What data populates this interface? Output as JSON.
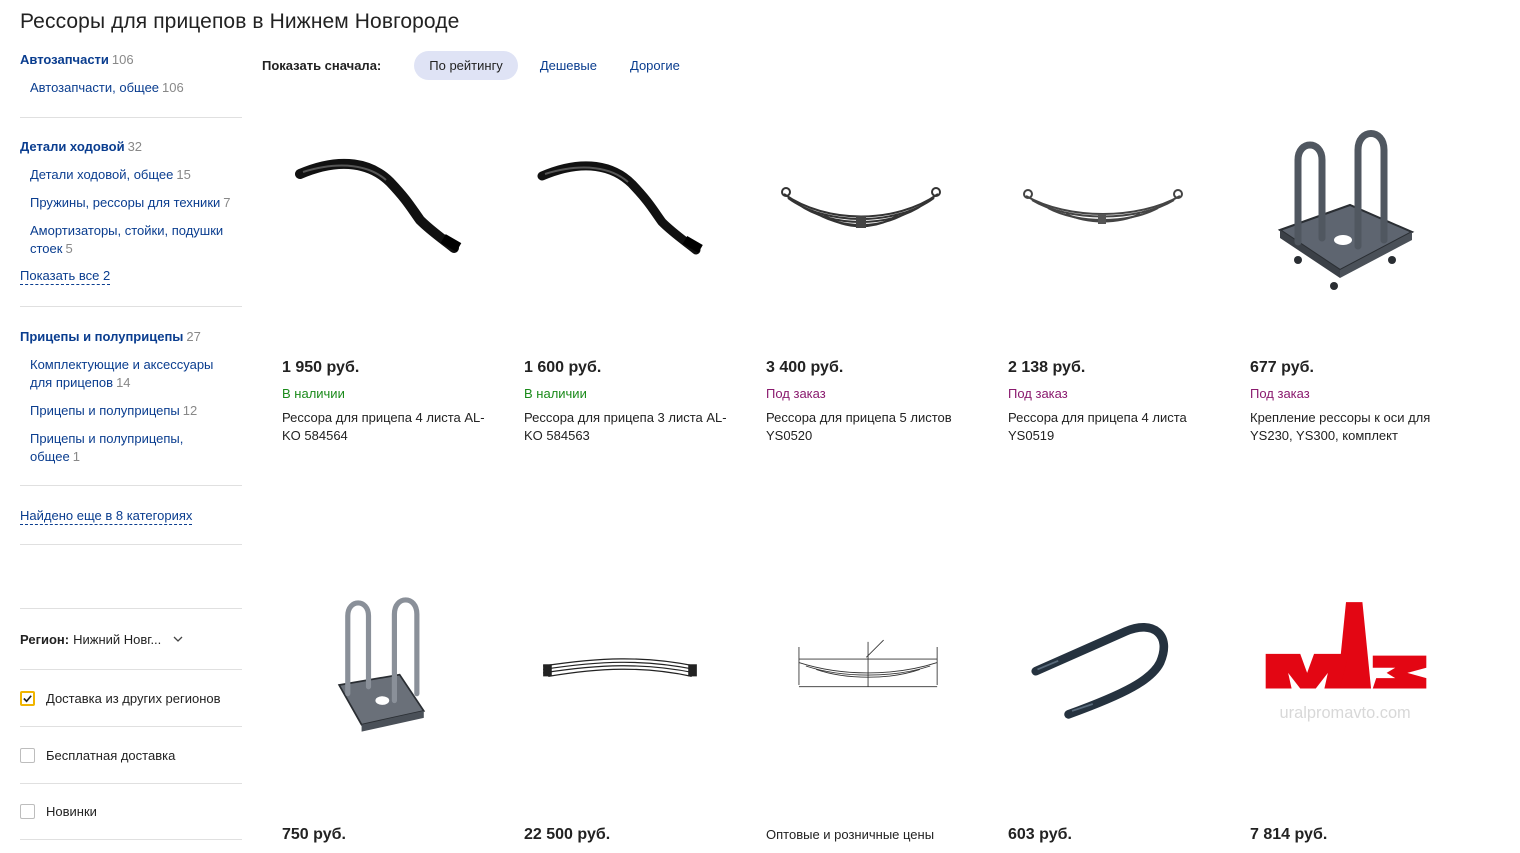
{
  "page": {
    "title": "Рессоры для прицепов в Нижнем Новгороде"
  },
  "sidebar": {
    "categories": [
      {
        "title": "Автозапчасти",
        "count": "106",
        "items": [
          {
            "label": "Автозапчасти, общее",
            "count": "106"
          }
        ]
      },
      {
        "title": "Детали ходовой",
        "count": "32",
        "items": [
          {
            "label": "Детали ходовой, общее",
            "count": "15"
          },
          {
            "label": "Пружины, рессоры для техники",
            "count": "7"
          },
          {
            "label": "Амортизаторы, стойки, подушки стоек",
            "count": "5"
          }
        ],
        "show_all": "Показать все 2"
      },
      {
        "title": "Прицепы и полуприцепы",
        "count": "27",
        "items": [
          {
            "label": "Комплектующие и аксессуары для прицепов",
            "count": "14"
          },
          {
            "label": "Прицепы и полуприцепы",
            "count": "12"
          },
          {
            "label": "Прицепы и полуприцепы, общее",
            "count": "1"
          }
        ]
      }
    ],
    "found_more": "Найдено еще в 8 категориях",
    "region_label": "Регион:",
    "region_value": "Нижний Новг...",
    "filters": [
      {
        "label": "Доставка из других регионов",
        "checked": true
      },
      {
        "label": "Бесплатная доставка",
        "checked": false
      },
      {
        "label": "Новинки",
        "checked": false
      }
    ]
  },
  "sort": {
    "label": "Показать сначала:",
    "options": [
      "По рейтингу",
      "Дешевые",
      "Дорогие"
    ],
    "active": "По рейтингу"
  },
  "products": [
    {
      "price": "1 950 руб.",
      "availability": "В наличии",
      "status": "in",
      "name": "Рессора для прицепа 4 листа AL-KO 584564",
      "image": "leaf-spring-curved"
    },
    {
      "price": "1 600 руб.",
      "availability": "В наличии",
      "status": "in",
      "name": "Рессора для прицепа 3 листа AL-KO 584563",
      "image": "leaf-spring-curved"
    },
    {
      "price": "3 400 руб.",
      "availability": "Под заказ",
      "status": "order",
      "name": "Рессора для прицепа 5 листов YS0520",
      "image": "leaf-spring"
    },
    {
      "price": "2 138 руб.",
      "availability": "Под заказ",
      "status": "order",
      "name": "Рессора для прицепа 4 листа YS0519",
      "image": "leaf-spring"
    },
    {
      "price": "677 руб.",
      "availability": "Под заказ",
      "status": "order",
      "name": "Крепление рессоры к оси для YS230, YS300, комплект",
      "image": "u-bolt-plate"
    },
    {
      "price": "750 руб.",
      "availability": "",
      "status": "",
      "name": "",
      "image": "u-bolt-plate"
    },
    {
      "price": "22 500 руб.",
      "availability": "",
      "status": "",
      "name": "",
      "image": "leaf-spring-stack"
    },
    {
      "price": "",
      "availability": "",
      "status": "",
      "name": "Оптовые и розничные цены уточняйте",
      "image": "spring-drawing"
    },
    {
      "price": "603 руб.",
      "availability": "",
      "status": "",
      "name": "",
      "image": "u-bolt"
    },
    {
      "price": "7 814 руб.",
      "availability": "",
      "status": "",
      "name": "",
      "image": "maz-logo"
    }
  ],
  "logo": {
    "brand_text": "МАЗ",
    "watermark": "uralpromavto.com",
    "color": "#e30613"
  }
}
